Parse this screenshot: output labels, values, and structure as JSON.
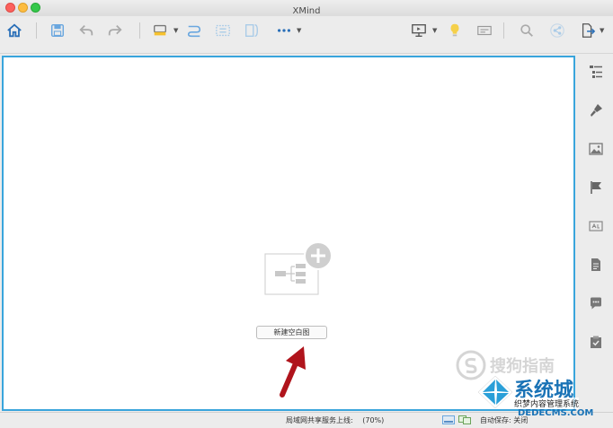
{
  "window": {
    "title": "XMind"
  },
  "canvas": {
    "new_blank_map_label": "新建空白图"
  },
  "statusbar": {
    "share_status": "局域网共享服务上线:",
    "zoom": "(70%)",
    "autosave": "自动保存: 关闭"
  },
  "watermark": {
    "sogou": "搜狗指南",
    "site": "系统城",
    "tagline": "织梦内容管理系统",
    "url": "DEDECMS.COM"
  },
  "colors": {
    "canvas_border": "#39a5dc",
    "arrow": "#b0141c",
    "accent_blue": "#2a7fd4"
  },
  "icons": {
    "toolbar": [
      "home-icon",
      "save-icon",
      "undo-icon",
      "redo-icon",
      "topic-style-icon",
      "relationship-icon",
      "boundary-icon",
      "summary-icon",
      "more-icon",
      "presentation-icon",
      "idea-icon",
      "outline-icon",
      "search-icon",
      "share-icon",
      "export-icon"
    ],
    "sidebar": [
      "outliner-icon",
      "format-icon",
      "image-icon",
      "marker-icon",
      "label-icon",
      "notes-icon",
      "comments-icon",
      "task-icon"
    ]
  }
}
